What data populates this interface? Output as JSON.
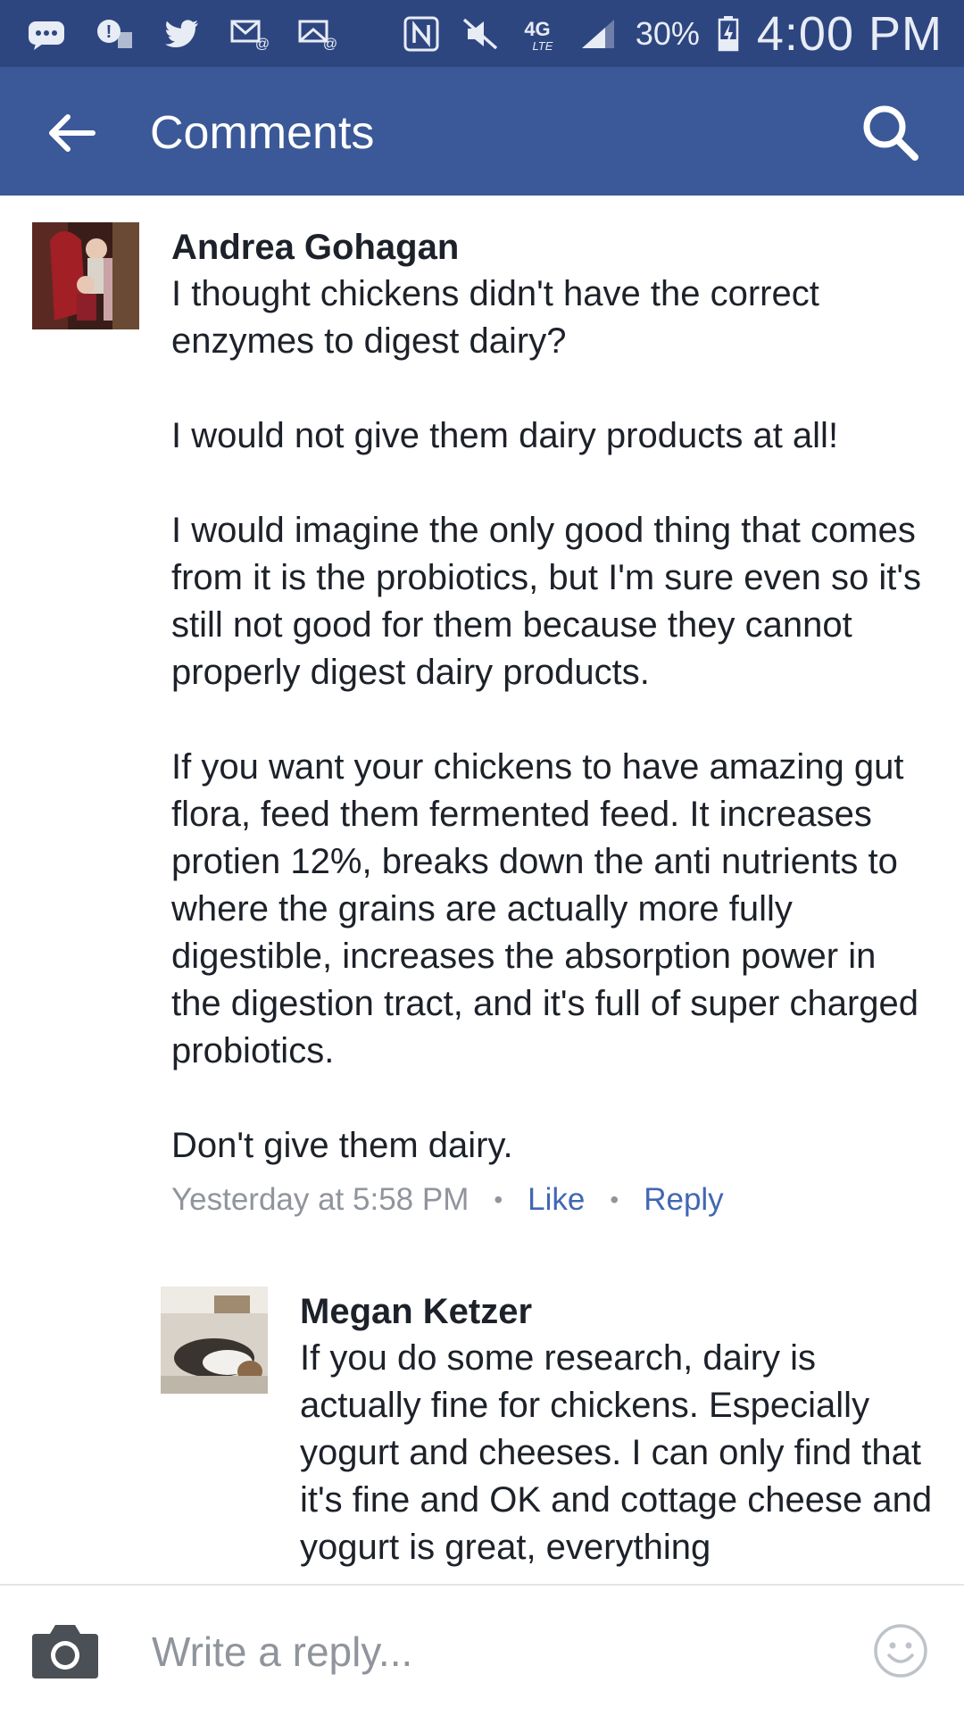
{
  "status_bar": {
    "battery_percent": "30%",
    "time": "4:00 PM",
    "network": "4G LTE",
    "icons": [
      "messenger-icon",
      "notification-icon",
      "twitter-icon",
      "email-icon",
      "email-alt-icon",
      "nfc-icon",
      "mute-icon",
      "network-4g-icon",
      "signal-icon",
      "battery-charging-icon"
    ]
  },
  "app_bar": {
    "title": "Comments",
    "back_icon": "arrow-left-icon",
    "search_icon": "search-icon",
    "color": "#3b5998"
  },
  "comments": [
    {
      "author": "Andrea Gohagan",
      "text": "I thought chickens didn't have the correct enzymes to digest dairy?\n\nI would not give them dairy products at all!\n\nI would imagine the only good thing that comes from it is the probiotics, but I'm sure even so it's still not good for them because they cannot properly digest dairy products.\n\nIf you want your chickens to have amazing gut flora, feed them fermented feed. It increases protien 12%, breaks down the anti nutrients to where the grains are actually more fully digestible, increases the absorption power in the digestion tract, and it's full of super charged probiotics.\n\nDon't give them dairy.",
      "timestamp": "Yesterday at 5:58 PM",
      "like_label": "Like",
      "reply_label": "Reply"
    },
    {
      "author": "Megan Ketzer",
      "text": "If you do some research, dairy is actually fine for chickens. Especially yogurt and cheeses. I can only find that it's fine and OK and cottage cheese and yogurt is great, everything"
    }
  ],
  "composer": {
    "placeholder": "Write a reply...",
    "camera_icon": "camera-icon",
    "emoji_icon": "emoji-icon"
  },
  "colors": {
    "status_bar": "#2e4680",
    "link": "#4267b2",
    "meta": "#90949c",
    "text": "#1d2129"
  }
}
